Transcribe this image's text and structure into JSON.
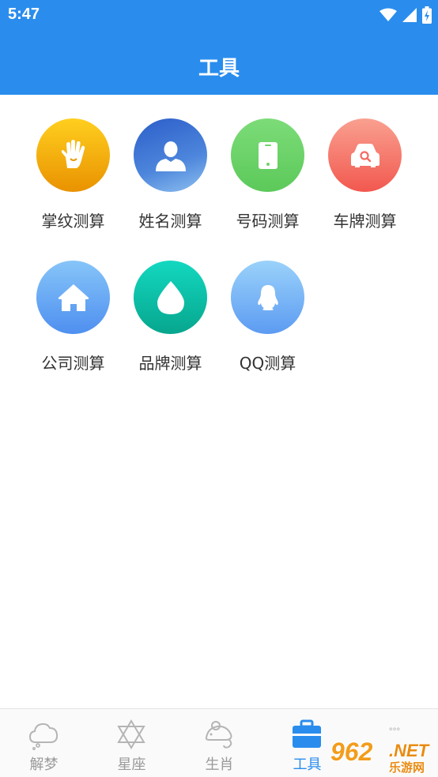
{
  "status_bar": {
    "time": "5:47",
    "icons": [
      "wifi-icon",
      "signal-icon",
      "battery-icon"
    ]
  },
  "header": {
    "title": "工具",
    "bg_color": "#2a8ded"
  },
  "tools": [
    {
      "label": "掌纹测算",
      "icon": "palm-icon",
      "color": "#f0a500"
    },
    {
      "label": "姓名测算",
      "icon": "person-icon",
      "color": "#3c6fd6"
    },
    {
      "label": "号码测算",
      "icon": "phone-icon",
      "color": "#6fd46a"
    },
    {
      "label": "车牌测算",
      "icon": "car-icon",
      "color": "#f56a62"
    },
    {
      "label": "公司测算",
      "icon": "house-icon",
      "color": "#5fa2f2"
    },
    {
      "label": "品牌测算",
      "icon": "drop-icon",
      "color": "#0fbfa8"
    },
    {
      "label": "QQ测算",
      "icon": "qq-penguin-icon",
      "color": "#6aaef5"
    }
  ],
  "tabbar": {
    "active_color": "#2a8ded",
    "tabs": [
      {
        "label": "解梦",
        "icon": "cloud-icon",
        "active": false
      },
      {
        "label": "星座",
        "icon": "star-of-david-icon",
        "active": false
      },
      {
        "label": "生肖",
        "icon": "mouse-icon",
        "active": false
      },
      {
        "label": "工具",
        "icon": "toolbox-icon",
        "active": true
      },
      {
        "label": "",
        "icon": "more-icon",
        "active": false
      }
    ]
  },
  "watermark": {
    "brand": "962",
    "domain": ".NET",
    "sub": "乐游网"
  }
}
